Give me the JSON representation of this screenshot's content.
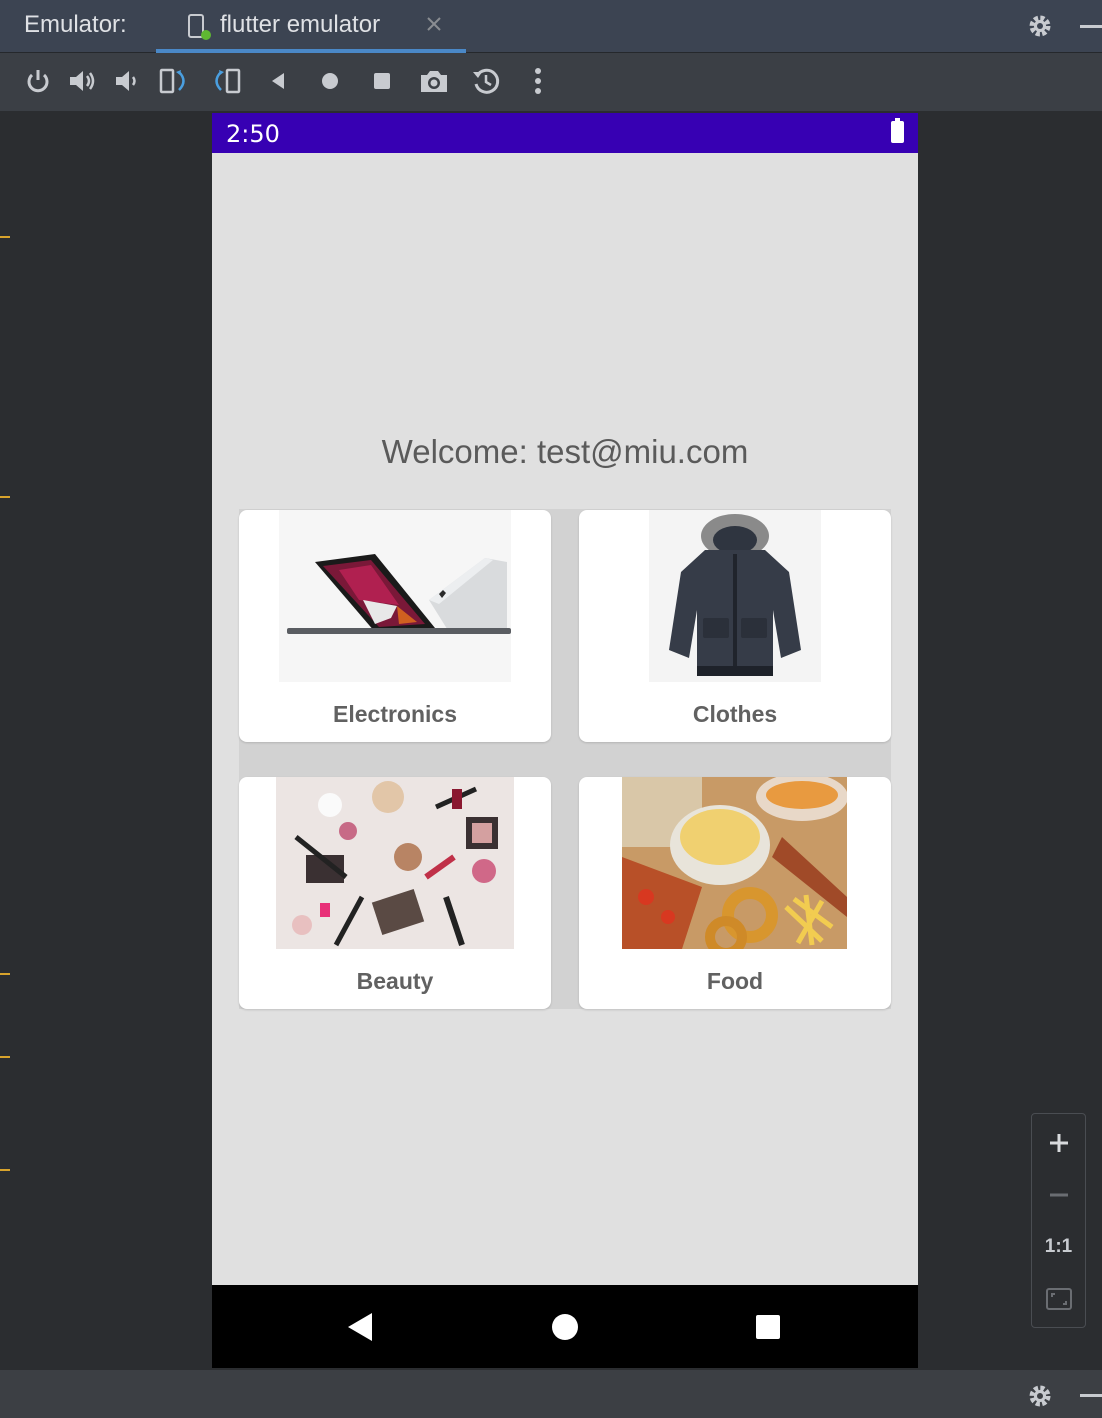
{
  "window": {
    "label": "Emulator:",
    "tab_title": "flutter emulator"
  },
  "toolbar": {
    "buttons": [
      "power-icon",
      "volume-up-icon",
      "volume-down-icon",
      "rotate-left-icon",
      "rotate-right-icon",
      "back-icon",
      "home-icon",
      "overview-icon",
      "screenshot-icon",
      "snapshot-icon",
      "more-icon"
    ]
  },
  "phone": {
    "status_time": "2:50",
    "welcome": "Welcome: test@miu.com",
    "categories": [
      {
        "label": "Electronics",
        "image": "laptop-image"
      },
      {
        "label": "Clothes",
        "image": "jacket-image"
      },
      {
        "label": "Beauty",
        "image": "cosmetics-image"
      },
      {
        "label": "Food",
        "image": "snacks-image"
      }
    ],
    "accent_color": "#3700b3"
  },
  "zoom": {
    "actual_size_label": "1:1"
  }
}
